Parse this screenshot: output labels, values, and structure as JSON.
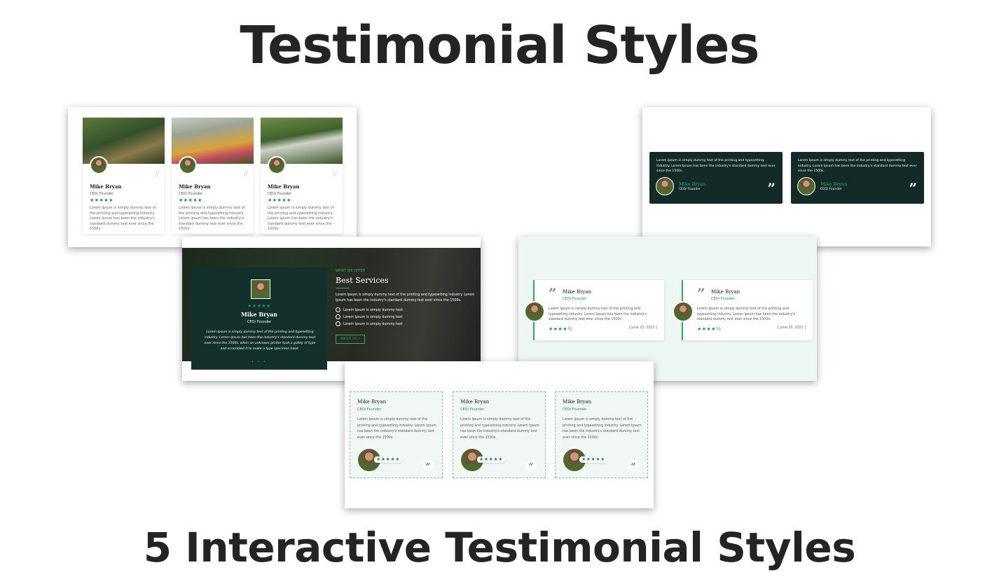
{
  "header": {
    "title": "Testimonial Styles"
  },
  "footer": {
    "title": "5 Interactive Testimonial Styles"
  },
  "common": {
    "name": "Mike Bryan",
    "role_style1": "CEO/ Founder",
    "role": "CEO/ Founder",
    "stars": "★★★★★",
    "slash": "//",
    "quote_mark": "”",
    "open_quote": "“",
    "text_short": "Lorem Ipsum is simply dummy text of the printing and typesetting industry. Lorem Ipsum has been the industry's standard dummy text ever since the 1500s.",
    "text_p1": "Lorem Ipsum is simply dummy text of the printing and typesetting industry. Lorem Ipsum has been the industry's standard dummy text ever since the 1500s.",
    "text_p2": "Lorem Ipsum is simply dummy text of the printing and typesetting industry. Lorem Ipsum has been the industry's standard dummy text ever since the 1500s.",
    "text_p4": "Lorem Ipsum is simply dummy text of the printing and typesetting industry. Lorem Ipsum has been the industry's standard dummy text ever since the 1500s.",
    "date": "[ June 25, 2021 ]",
    "stars_half": "★★★★½"
  },
  "style3": {
    "kicker": "WHAT WE OFFER",
    "heading": "Best Services",
    "intro": "Lorem Ipsum is simply dummy text of the printing and typesetting industry. Lorem Ipsum has been the industry's standard dummy text ever since the 1500s.",
    "checks": [
      "Lorem Ipsum is simply dummy text.",
      "Lorem Ipsum is simply dummy text",
      "Lorem Ipsum is simply dummy text"
    ],
    "button": "ABOUT US +",
    "quote_text": "Lorem Ipsum is simply dummy text of the printing and typesetting industry. Lorem Ipsum has been the industry's standard dummy text ever since the 1500s, when an unknown printer took a galley of type and scrambled it to make a type specimen book.",
    "dots": "• • •"
  },
  "colors": {
    "accent": "#1f8f52",
    "dark": "#132a28",
    "title": "#242424"
  }
}
